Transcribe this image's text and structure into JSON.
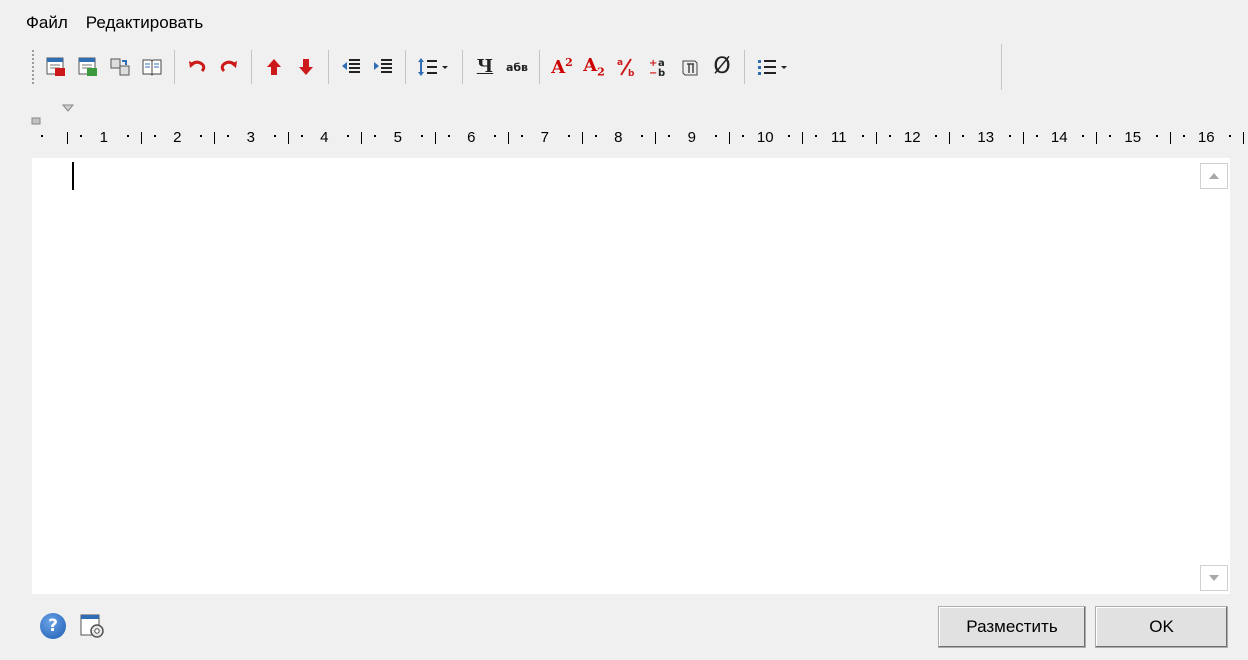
{
  "menu": {
    "items": [
      "Файл",
      "Редактировать"
    ]
  },
  "toolbar": {
    "groups": [
      [
        "import-text-icon",
        "export-text-icon",
        "find-replace-icon",
        "dictionary-icon"
      ],
      [
        "undo-icon",
        "redo-icon"
      ],
      [
        "move-up-icon",
        "move-down-icon"
      ],
      [
        "decrease-indent-icon",
        "increase-indent-icon"
      ],
      [
        "line-spacing-icon"
      ],
      [
        "underline-icon",
        "lowercase-icon"
      ],
      [
        "superscript-icon",
        "subscript-icon",
        "fraction-icon",
        "tolerance-icon",
        "symbol-icon",
        "diameter-icon"
      ],
      [
        "list-icon"
      ]
    ],
    "underline_label": "Ч",
    "lowercase_label": "абв",
    "superscript_label": "A",
    "superscript_exp": "2",
    "subscript_label": "A",
    "subscript_idx": "2",
    "fraction_label": "⁄",
    "diameter_label": "Ø"
  },
  "ruler": {
    "labels": [
      "1",
      "2",
      "3",
      "4",
      "5",
      "6",
      "7",
      "8",
      "9",
      "10",
      "11",
      "12",
      "13",
      "14",
      "15",
      "16"
    ]
  },
  "colors": {
    "accent_red": "#cc1a1a",
    "icon_blue": "#2f6db5"
  },
  "buttons": {
    "place_label": "Разместить",
    "ok_label": "OK"
  },
  "bottom": {
    "help_label": "?"
  }
}
